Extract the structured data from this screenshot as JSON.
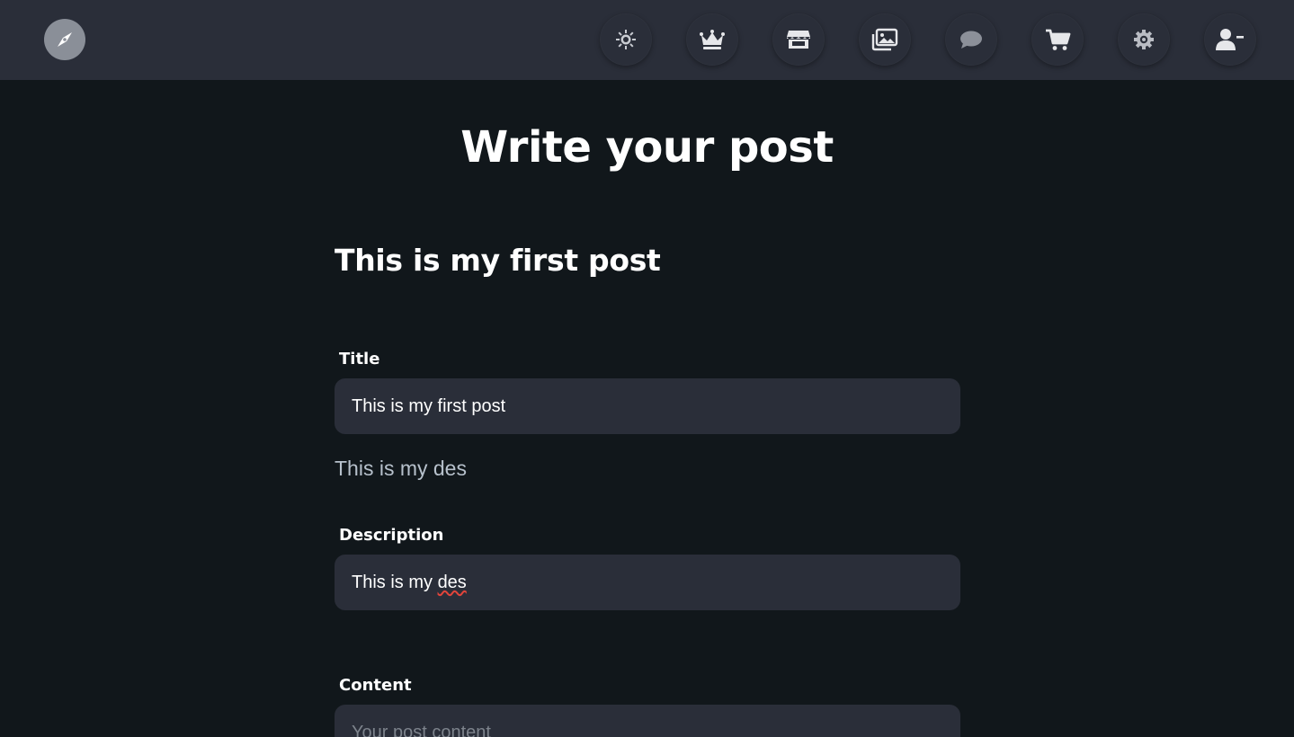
{
  "nav": {
    "logo_icon": "compass-icon",
    "items": [
      {
        "icon": "sun-icon"
      },
      {
        "icon": "crown-icon"
      },
      {
        "icon": "store-icon"
      },
      {
        "icon": "images-icon"
      },
      {
        "icon": "chat-icon"
      },
      {
        "icon": "cart-icon"
      },
      {
        "icon": "gear-icon"
      },
      {
        "icon": "user-minus-icon"
      }
    ]
  },
  "page": {
    "title": "Write your post"
  },
  "preview": {
    "title": "This is my first post",
    "description": "This is my des"
  },
  "form": {
    "title": {
      "label": "Title",
      "value": "This is my first post"
    },
    "description": {
      "label": "Description",
      "value_plain": "This is my ",
      "value_misspelled": "des"
    },
    "content": {
      "label": "Content",
      "placeholder": "Your post content"
    }
  },
  "colors": {
    "background": "#11171b",
    "topbar": "#2a2e39",
    "field": "#2a2e39",
    "muted_text": "#b7c1cc"
  }
}
